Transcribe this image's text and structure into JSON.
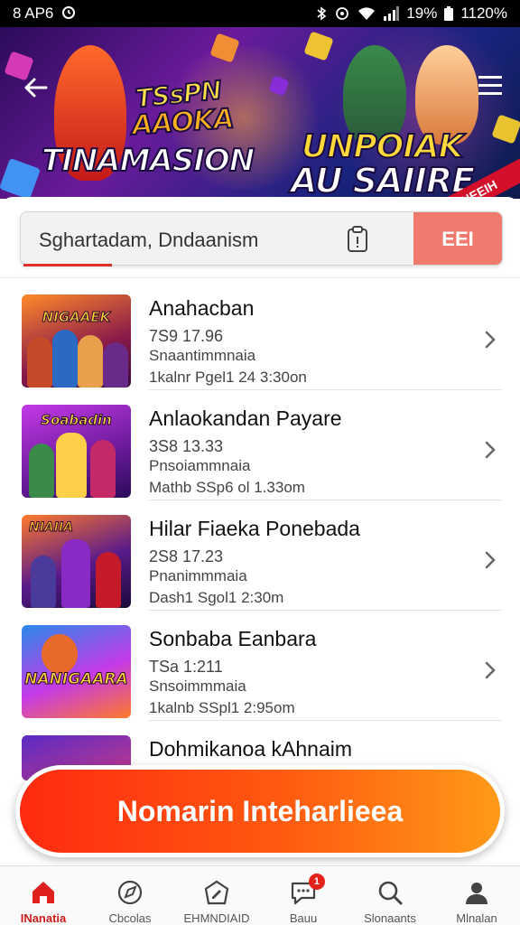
{
  "status_bar": {
    "left_text": "8 AP6",
    "battery": "19%",
    "time": "1120%"
  },
  "banner": {
    "title_line1": "TSsPN",
    "title_line2": "AAOKA",
    "title_line3": "TINAMASION",
    "title_line4": "UNPOIAK",
    "title_line5": "AU SAIIRE",
    "corner_tag": "INEEIH"
  },
  "search": {
    "value": "Sghartadam, Dndaanism",
    "filter_label": "EEI"
  },
  "events": [
    {
      "thumb_title": "NIGAAEK",
      "title": "Anahacban",
      "line1": "7S9 17.96",
      "line2": "Snaantimmnaia",
      "line3": "1kalnr Pgel1 24 3:30on"
    },
    {
      "thumb_title": "Soabadin",
      "title": "Anlaokandan Payare",
      "line1": "3S8 13.33",
      "line2": "Pnsoiammnaia",
      "line3": "Mathb SSp6 ol 1.33om"
    },
    {
      "thumb_title": "NIAIIA",
      "title": "Hilar Fiaeka Ponebada",
      "line1": "2S8 17.23",
      "line2": "Pnanimmmaia",
      "line3": "Dash1 Sgol1 2:30m"
    },
    {
      "thumb_title": "NANIGAARA",
      "title": "Sonbaba Eanbara",
      "line1": "TSa 1:211",
      "line2": "Snsoimmmaia",
      "line3": "1kalnb SSpl1 2:95om"
    },
    {
      "thumb_title": "",
      "title": "Dohmikanoa kAhnaim",
      "line1": "",
      "line2": "",
      "line3": ""
    }
  ],
  "cta": {
    "label": "Nomarin Inteharlieea"
  },
  "bottom_nav": [
    {
      "label": "INanatia",
      "icon": "home-icon",
      "active": true
    },
    {
      "label": "Cbcolas",
      "icon": "compass-icon",
      "active": false
    },
    {
      "label": "EHMNDIAID",
      "icon": "edit-icon",
      "active": false
    },
    {
      "label": "Bauu",
      "icon": "chat-icon",
      "active": false,
      "badge": "1"
    },
    {
      "label": "Slonaants",
      "icon": "search-icon",
      "active": false
    },
    {
      "label": "Mlnalan",
      "icon": "profile-icon",
      "active": false
    }
  ],
  "colors": {
    "accent": "#e0302a",
    "filter": "#f07a6e",
    "cta_start": "#ff2a10",
    "cta_end": "#ff9a18",
    "active_nav": "#d11a1a"
  }
}
